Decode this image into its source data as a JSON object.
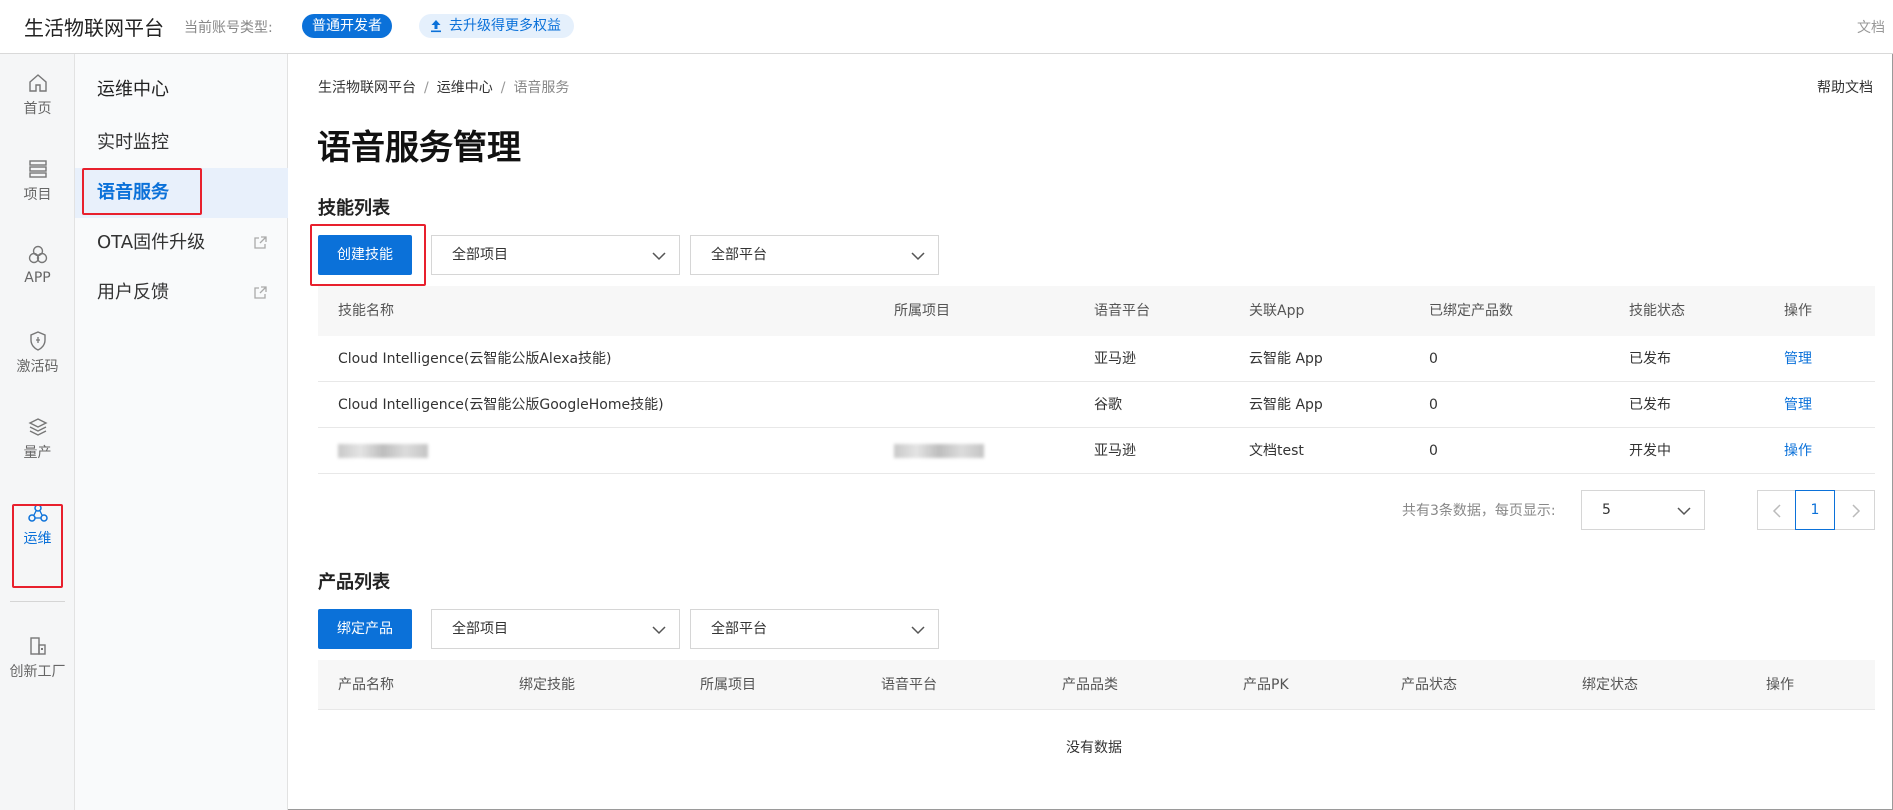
{
  "topbar": {
    "brand": "生活物联网平台",
    "account_type_label": "当前账号类型:",
    "account_type_badge": "普通开发者",
    "upgrade_label": "去升级得更多权益",
    "doc_label": "文档"
  },
  "rail": {
    "items": [
      {
        "label": "首页",
        "icon": "home-icon"
      },
      {
        "label": "项目",
        "icon": "list-icon"
      },
      {
        "label": "APP",
        "icon": "app-icon"
      },
      {
        "label": "激活码",
        "icon": "shield-icon"
      },
      {
        "label": "量产",
        "icon": "layers-icon"
      },
      {
        "label": "运维",
        "icon": "ops-icon"
      },
      {
        "label": "创新工厂",
        "icon": "factory-icon"
      }
    ],
    "active": "运维"
  },
  "subnav": {
    "heading": "运维中心",
    "items": [
      {
        "label": "实时监控"
      },
      {
        "label": "语音服务"
      },
      {
        "label": "OTA固件升级"
      },
      {
        "label": "用户反馈"
      }
    ],
    "active": "语音服务"
  },
  "main": {
    "breadcrumb": [
      "生活物联网平台",
      "运维中心",
      "语音服务"
    ],
    "breadcrumb_sep": "/",
    "help_label": "帮助文档",
    "title": "语音服务管理",
    "skills": {
      "section_title": "技能列表",
      "create_button": "创建技能",
      "project_filter": "全部项目",
      "platform_filter": "全部平台",
      "columns": [
        "技能名称",
        "所属项目",
        "语音平台",
        "关联App",
        "已绑定产品数",
        "技能状态",
        "操作"
      ],
      "rows": [
        {
          "name": "Cloud Intelligence(云智能公版Alexa技能)",
          "project": "",
          "platform": "亚马逊",
          "app": "云智能 App",
          "bound": "0",
          "status": "已发布",
          "action": "管理"
        },
        {
          "name": "Cloud Intelligence(云智能公版GoogleHome技能)",
          "project": "",
          "platform": "谷歌",
          "app": "云智能 App",
          "bound": "0",
          "status": "已发布",
          "action": "管理"
        },
        {
          "name": "",
          "project": "",
          "platform": "亚马逊",
          "app": "文档test",
          "bound": "0",
          "status": "开发中",
          "action": "操作"
        }
      ],
      "pagination": {
        "summary": "共有3条数据，每页显示:",
        "page_size": "5",
        "current_page": "1"
      }
    },
    "products": {
      "section_title": "产品列表",
      "bind_button": "绑定产品",
      "project_filter": "全部项目",
      "platform_filter": "全部平台",
      "columns": [
        "产品名称",
        "绑定技能",
        "所属项目",
        "语音平台",
        "产品品类",
        "产品PK",
        "产品状态",
        "绑定状态",
        "操作"
      ],
      "empty_text": "没有数据"
    }
  },
  "colors": {
    "accent": "#0b71d9",
    "highlight_box": "#e8202d",
    "active_bg": "#e8f0fb"
  }
}
